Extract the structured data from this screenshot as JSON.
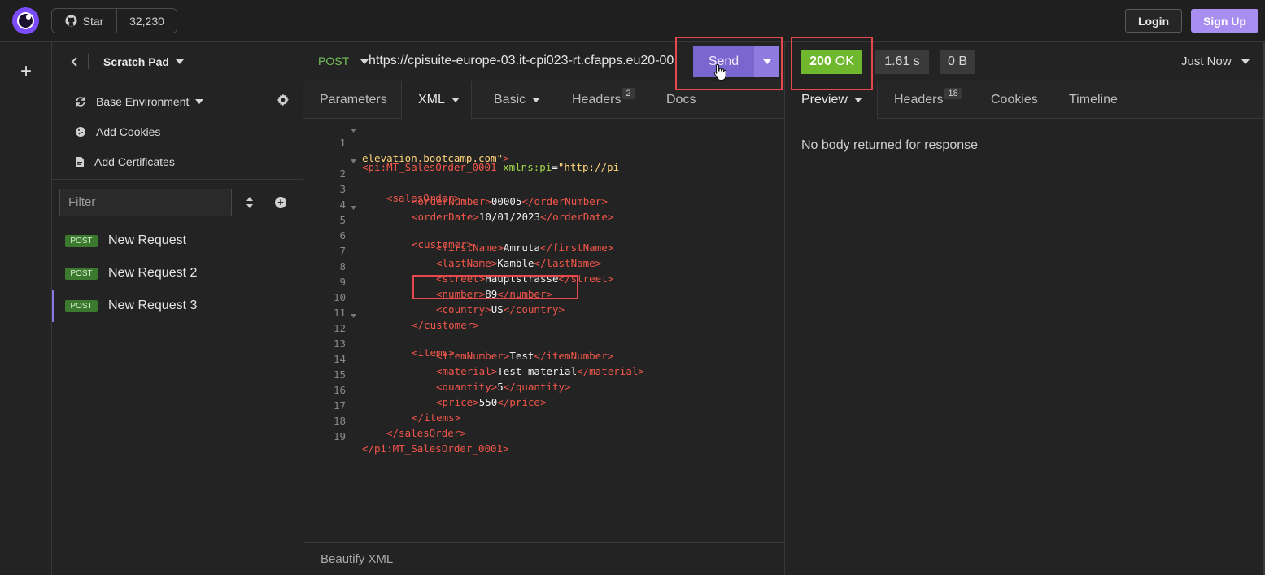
{
  "header": {
    "star_label": "Star",
    "star_count": "32,230",
    "login_label": "Login",
    "signup_label": "Sign Up"
  },
  "sidebar": {
    "title": "Scratch Pad",
    "environment": "Base Environment",
    "add_cookies": "Add Cookies",
    "add_certificates": "Add Certificates",
    "filter_placeholder": "Filter",
    "requests": [
      {
        "method": "POST",
        "label": "New Request"
      },
      {
        "method": "POST",
        "label": "New Request 2"
      },
      {
        "method": "POST",
        "label": "New Request 3"
      }
    ]
  },
  "request": {
    "method": "POST",
    "url": "https://cpisuite-europe-03.it-cpi023-rt.cfapps.eu20-00",
    "send_label": "Send",
    "tabs": {
      "parameters": "Parameters",
      "body": "XML",
      "auth": "Basic",
      "headers": "Headers",
      "headers_count": "2",
      "docs": "Docs"
    },
    "beautify_label": "Beautify XML",
    "line_numbers": [
      "1",
      "2",
      "3",
      "4",
      "5",
      "6",
      "7",
      "8",
      "9",
      "10",
      "11",
      "12",
      "13",
      "14",
      "15",
      "16",
      "17",
      "18",
      "19"
    ],
    "xml": {
      "root_open": "<pi:MT_SalesOrder_0001",
      "ns_attr": "xmlns:pi",
      "ns_eq": "=",
      "ns_value_1": "\"http://pi-",
      "ns_value_2": "elevation.bootcamp.com\"",
      "root_close_bracket": ">",
      "sales_open": "<salesOrder>",
      "order_number_open": "<orderNumber>",
      "order_number": "00005",
      "order_number_close": "</orderNumber>",
      "order_date_open": "<orderDate>",
      "order_date": "10/01/2023",
      "order_date_close": "</orderDate>",
      "customer_open": "<customer>",
      "first_name_open": "<firstName>",
      "first_name": "Amruta",
      "first_name_close": "</firstName>",
      "last_name_open": "<lastName>",
      "last_name": "Kamble",
      "last_name_close": "</lastName>",
      "street_open": "<street>",
      "street": "Hauptstrasse",
      "street_close": "</street>",
      "number_open": "<number>",
      "number": "89",
      "number_close": "</number>",
      "country_open": "<country>",
      "country": "US",
      "country_close": "</country>",
      "customer_close": "</customer>",
      "items_open": "<items>",
      "item_number_open": "<itemNumber>",
      "item_number": "Test",
      "item_number_close": "</itemNumber>",
      "material_open": "<material>",
      "material": "Test_material",
      "material_close": "</material>",
      "quantity_open": "<quantity>",
      "quantity": "5",
      "quantity_close": "</quantity>",
      "price_open": "<price>",
      "price": "550",
      "price_close": "</price>",
      "items_close": "</items>",
      "sales_close": "</salesOrder>",
      "root_end": "</pi:MT_SalesOrder_0001>"
    }
  },
  "response": {
    "status_code": "200",
    "status_text": "OK",
    "time": "1.61 s",
    "size": "0 B",
    "timestamp": "Just Now",
    "tabs": {
      "preview": "Preview",
      "headers": "Headers",
      "headers_count": "18",
      "cookies": "Cookies",
      "timeline": "Timeline"
    },
    "empty_message": "No body returned for response"
  },
  "colors": {
    "accent": "#7a66cf",
    "status_ok": "#6fb72c",
    "post_badge": "#3b7a2e",
    "xml_tag": "#f2564a",
    "xml_attr": "#9fd64a",
    "xml_string": "#ffd57a",
    "highlight": "#e5484d"
  }
}
